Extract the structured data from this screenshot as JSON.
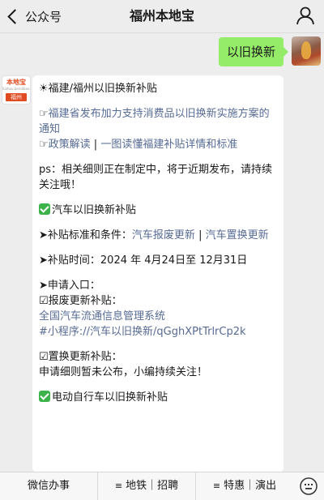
{
  "header": {
    "back_label": "公众号",
    "title": "福州本地宝"
  },
  "my_message": {
    "text": "以旧换新"
  },
  "account_logo": {
    "brand": "本地宝",
    "url": "fuzhou.bendibao.com",
    "city": "福州"
  },
  "reply": {
    "heading": "☀福建/福州以旧换新补贴",
    "pointer_prefix": "☞",
    "link_policy": "福建省发布加力支持消费品以旧换新实施方案的通知",
    "link_interpretation": "政策解读",
    "separator": " | ",
    "link_one_chart": "一图读懂福建补贴详情和标准",
    "ps": "ps：相关细则正在制定中，将于近期发布，请持续关注哦！",
    "car_heading": "汽车以旧换新补贴",
    "arrow": "➤",
    "standard_label": "补贴标准和条件：",
    "link_scrap": "汽车报废更新",
    "link_replace": "汽车置换更新",
    "time_text": "补贴时间：2024 年 4月24日至 12月31日",
    "entry_label": "申请入口：",
    "box": "☑",
    "scrap_label": "报废更新补贴：",
    "link_system": "全国汽车流通信息管理系统",
    "link_miniprogram": "#小程序://汽车以旧换新/qGghXPtTrlrCp2k",
    "replace_label": "置换更新补贴：",
    "replace_note": "申请细则暂未公布，小编持续关注！",
    "ebike_heading": "电动自行车以旧换新补贴"
  },
  "bottom_menu": {
    "menu1": "微信办事",
    "menu2": "地铁｜招聘",
    "menu3": "特惠｜演出",
    "menu_glyph": "≡"
  },
  "colors": {
    "my_bubble": "#95ec69",
    "link": "#576b95",
    "check": "#3cb34a",
    "background": "#ededed"
  }
}
